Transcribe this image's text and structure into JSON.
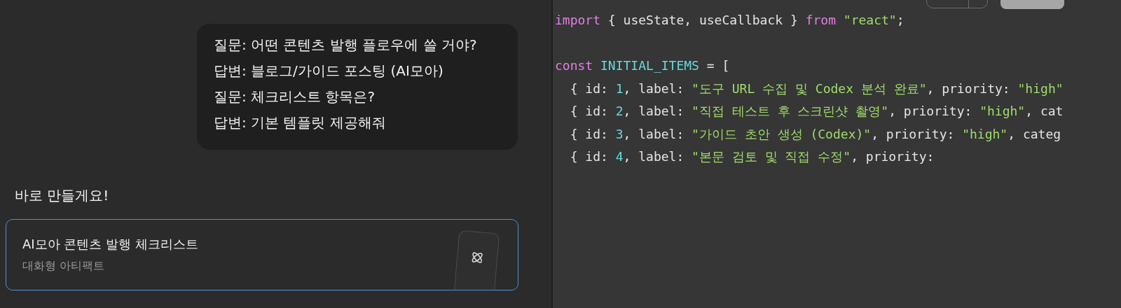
{
  "chat": {
    "user_bubble": [
      {
        "question": "질문: 어떤 콘텐츠 발행 플로우에 쓸 거야?",
        "answer": "답변: 블로그/가이드 포스팅 (AI모아)"
      },
      {
        "question": "질문: 체크리스트 항목은?",
        "answer": "답변: 기본 템플릿 제공해줘"
      }
    ],
    "reply": "바로 만들게요!",
    "artifact": {
      "title": "AI모아 콘텐츠 발행 체크리스트",
      "subtitle": "대화형 아티팩트"
    }
  },
  "code_editor": {
    "lines": [
      {
        "kind": "code",
        "tokens": [
          {
            "kind": "keyword",
            "text": "import"
          },
          {
            "kind": "plain",
            "text": " { useState, useCallback } "
          },
          {
            "kind": "keyword",
            "text": "from"
          },
          {
            "kind": "string",
            "text": " \"react\""
          },
          {
            "kind": "plain",
            "text": ";"
          }
        ]
      },
      {
        "kind": "blank"
      },
      {
        "kind": "code",
        "tokens": [
          {
            "kind": "keyword",
            "text": "const"
          },
          {
            "kind": "constant",
            "text": " INITIAL_ITEMS"
          },
          {
            "kind": "plain",
            "text": " = ["
          }
        ]
      },
      {
        "kind": "code",
        "tokens": [
          {
            "kind": "plain",
            "text": "  { id: "
          },
          {
            "kind": "number",
            "text": "1"
          },
          {
            "kind": "plain",
            "text": ", label: "
          },
          {
            "kind": "string",
            "text": "\"도구 URL 수집 및 Codex 분석 완료\""
          },
          {
            "kind": "plain",
            "text": ", priority: "
          },
          {
            "kind": "string",
            "text": "\"high\""
          }
        ]
      },
      {
        "kind": "code",
        "tokens": [
          {
            "kind": "plain",
            "text": "  { id: "
          },
          {
            "kind": "number",
            "text": "2"
          },
          {
            "kind": "plain",
            "text": ", label: "
          },
          {
            "kind": "string",
            "text": "\"직접 테스트 후 스크린샷 촬영\""
          },
          {
            "kind": "plain",
            "text": ", priority: "
          },
          {
            "kind": "string",
            "text": "\"high\""
          },
          {
            "kind": "plain",
            "text": ", cat"
          }
        ]
      },
      {
        "kind": "code",
        "tokens": [
          {
            "kind": "plain",
            "text": "  { id: "
          },
          {
            "kind": "number",
            "text": "3"
          },
          {
            "kind": "plain",
            "text": ", label: "
          },
          {
            "kind": "string",
            "text": "\"가이드 초안 생성 (Codex)\""
          },
          {
            "kind": "plain",
            "text": ", priority: "
          },
          {
            "kind": "string",
            "text": "\"high\""
          },
          {
            "kind": "plain",
            "text": ", categ"
          }
        ]
      },
      {
        "kind": "code",
        "tokens": [
          {
            "kind": "plain",
            "text": "  { id: "
          },
          {
            "kind": "number",
            "text": "4"
          },
          {
            "kind": "plain",
            "text": ", label: "
          },
          {
            "kind": "string",
            "text": "\"본문 검토 및 직접 수정\""
          },
          {
            "kind": "plain",
            "text": ", priority:"
          }
        ]
      }
    ]
  }
}
